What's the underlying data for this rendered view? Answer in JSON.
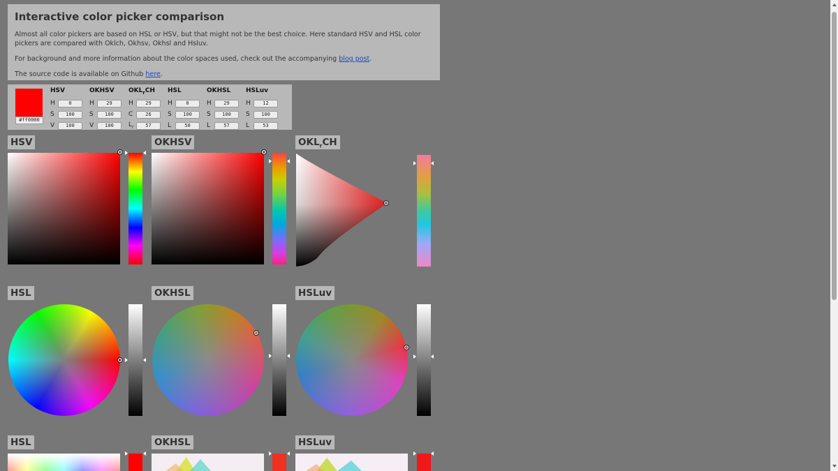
{
  "intro": {
    "title": "Interactive color picker comparison",
    "p1": "Almost all color pickers are based on HSL or HSV, but that might not be the best choice. Here standard HSV and HSL color pickers are compared with Oklch, Okhsv, Okhsl and Hsluv.",
    "p2_before": "For background and more information about the color spaces used, check out the accompanying ",
    "p2_link": "blog post",
    "p2_after": ".",
    "p3_before": "The source code is available on Github ",
    "p3_link": "here",
    "p3_after": "."
  },
  "panel": {
    "swatch_color": "#ff0000",
    "hex": "#ff0000",
    "columns": [
      {
        "title": "HSV",
        "rows": [
          {
            "label": "H",
            "value": "0"
          },
          {
            "label": "S",
            "value": "100"
          },
          {
            "label": "V",
            "value": "100"
          }
        ]
      },
      {
        "title": "OKHSV",
        "rows": [
          {
            "label": "H",
            "value": "29"
          },
          {
            "label": "S",
            "value": "100"
          },
          {
            "label": "V",
            "value": "100"
          }
        ]
      },
      {
        "title_main": "OKL",
        "title_sub": "r",
        "title_rest": "CH",
        "rows": [
          {
            "label": "H",
            "value": "29"
          },
          {
            "label": "C",
            "value": "26"
          },
          {
            "label": "L",
            "label_sub": "r",
            "value": "57"
          }
        ]
      },
      {
        "title": "HSL",
        "rows": [
          {
            "label": "H",
            "value": "0"
          },
          {
            "label": "S",
            "value": "100"
          },
          {
            "label": "L",
            "value": "50"
          }
        ]
      },
      {
        "title": "OKHSL",
        "rows": [
          {
            "label": "H",
            "value": "29"
          },
          {
            "label": "S",
            "value": "100"
          },
          {
            "label": "L",
            "value": "57"
          }
        ]
      },
      {
        "title": "HSLuv",
        "rows": [
          {
            "label": "H",
            "value": "12"
          },
          {
            "label": "S",
            "value": "100"
          },
          {
            "label": "L",
            "value": "53"
          }
        ]
      }
    ]
  },
  "sections": {
    "hsv": "HSV",
    "okhsv": "OKHSV",
    "oklrch_main": "OKL",
    "oklrch_sub": "r",
    "oklrch_rest": "CH",
    "hsl_wheel": "HSL",
    "okhsl_wheel": "OKHSL",
    "hsluv_wheel": "HSLuv",
    "hsl_bottom": "HSL",
    "okhsl_bottom": "OKHSL",
    "hsluv_bottom": "HSLuv"
  },
  "icons": {
    "slider_marker": "triangle-arrow-icon",
    "picker_handle": "circle-handle-icon"
  }
}
